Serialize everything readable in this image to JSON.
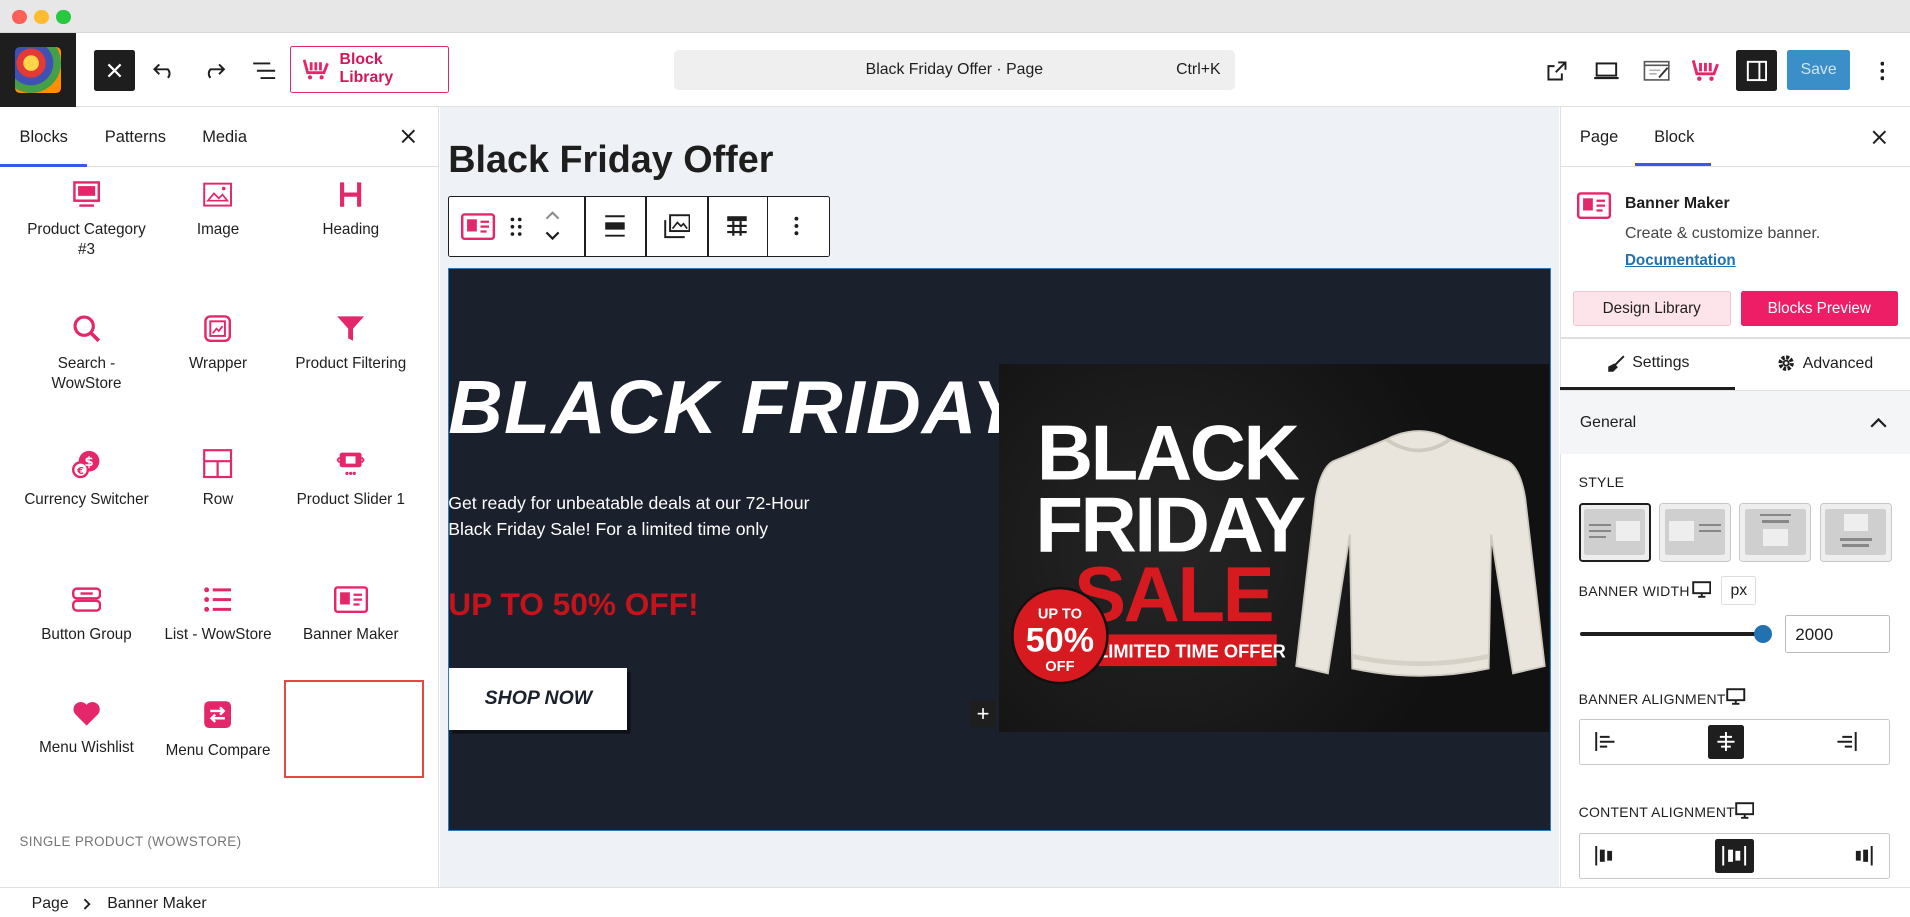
{
  "toolbar": {
    "block_library_label": "Block Library",
    "command_title": "Black Friday Offer · Page",
    "command_shortcut": "Ctrl+K",
    "save_label": "Save"
  },
  "inserter": {
    "tabs": [
      "Blocks",
      "Patterns",
      "Media"
    ],
    "active_tab": "Blocks",
    "blocks": [
      {
        "label": "Product Category #3",
        "icon": "product-category-icon"
      },
      {
        "label": "Image",
        "icon": "image-icon"
      },
      {
        "label": "Heading",
        "icon": "heading-icon"
      },
      {
        "label": "Search - WowStore",
        "icon": "search-icon"
      },
      {
        "label": "Wrapper",
        "icon": "wrapper-icon"
      },
      {
        "label": "Product Filtering",
        "icon": "filter-icon"
      },
      {
        "label": "Currency Switcher",
        "icon": "currency-icon"
      },
      {
        "label": "Row",
        "icon": "row-icon"
      },
      {
        "label": "Product Slider 1",
        "icon": "product-slider-icon"
      },
      {
        "label": "Button Group",
        "icon": "button-group-icon"
      },
      {
        "label": "List - WowStore",
        "icon": "list-icon"
      },
      {
        "label": "Banner Maker",
        "icon": "banner-maker-icon"
      },
      {
        "label": "Menu Wishlist",
        "icon": "heart-icon"
      },
      {
        "label": "Menu Compare",
        "icon": "compare-icon"
      }
    ],
    "section_label": "SINGLE PRODUCT (WOWSTORE)"
  },
  "editor": {
    "page_title": "Black Friday Offer",
    "banner": {
      "heading": "BLACK FRIDAY",
      "description": "Get ready for unbeatable deals at our 72-Hour Black Friday Sale! For a limited time only",
      "offer": "UP TO 50% OFF!",
      "button": "SHOP NOW",
      "image_text": {
        "line1": "BLACK",
        "line2": "FRIDAY",
        "line3": "SALE",
        "badge_top": "UP TO",
        "badge_pct": "50%",
        "badge_bottom": "OFF",
        "ribbon": "LIMITED TIME OFFER"
      }
    }
  },
  "settings": {
    "tabs": [
      "Page",
      "Block"
    ],
    "active_tab": "Block",
    "block_name": "Banner Maker",
    "block_desc": "Create & customize banner.",
    "doc_link": "Documentation",
    "design_library": "Design Library",
    "blocks_preview": "Blocks Preview",
    "subtabs": [
      "Settings",
      "Advanced"
    ],
    "panel_title": "General",
    "style_label": "STYLE",
    "banner_width_label": "BANNER WIDTH",
    "banner_width_unit": "px",
    "banner_width_value": "2000",
    "banner_width_fraction": 1.0,
    "banner_alignment_label": "BANNER ALIGNMENT",
    "content_alignment_label": "CONTENT ALIGNMENT"
  },
  "breadcrumb": [
    "Page",
    "Banner Maker"
  ],
  "colors": {
    "accent": "#ed1e65",
    "wp_blue": "#3858e9",
    "save_blue": "#3a8fc9",
    "banner_bg": "#1a202c",
    "offer_red": "#c4141b"
  }
}
